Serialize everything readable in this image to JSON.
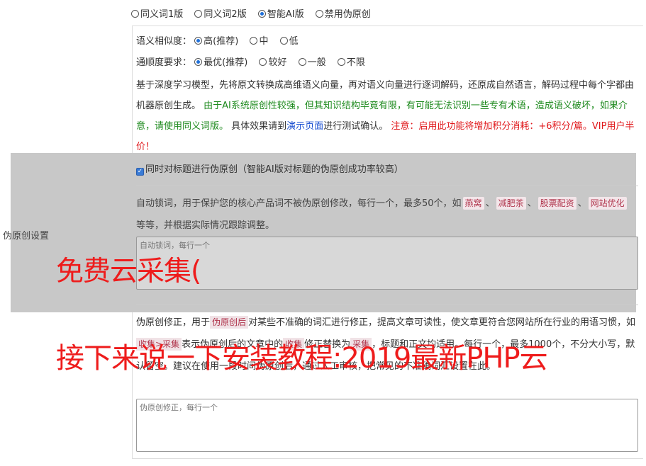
{
  "version_options": [
    {
      "label": "同义词1版",
      "selected": false
    },
    {
      "label": "同义词2版",
      "selected": false
    },
    {
      "label": "智能AI版",
      "selected": true
    },
    {
      "label": "禁用伪原创",
      "selected": false
    }
  ],
  "similarity": {
    "label": "语义相似度：",
    "options": [
      "高(推荐)",
      "中",
      "低"
    ]
  },
  "fluency": {
    "label": "通顺度要求：",
    "options": [
      "最优(推荐)",
      "较好",
      "一般",
      "不限"
    ]
  },
  "description": {
    "part1": "基于深度学习模型，先将原文转换成高维语义向量，再对语义向量进行逐词解码，还原成自然语言，解码过程中每个字都由机器原创生成。",
    "part2_green": "由于AI系统原创性较强，但其知识结构毕竟有限，有可能无法识别一些专有术语，造成语义破坏，如果介意，请使用同义词版。",
    "part3": "具体效果请到",
    "link": "演示页面",
    "part4": "进行测试确认。",
    "warning": "注意：启用此功能将增加积分消耗：+6积分/篇。VIP用户半价！"
  },
  "side_label": "伪原创设置",
  "title_checkbox": {
    "label": "同时对标题进行伪原创（智能AI版对标题的伪原创成功率较高）",
    "checked": true
  },
  "lock_words": {
    "text1": "自动锁词，用于保护您的核心产品词不被伪原创修改，每行一个，最多50个，如",
    "tags": [
      "燕窝",
      "减肥茶",
      "股票配资",
      "网站优化"
    ],
    "text2": "等等，并根据实际情况跟踪调整。",
    "placeholder": "自动锁词，每行一个"
  },
  "correction": {
    "text1": "伪原创修正，用于",
    "tag1": "伪原创后",
    "text2": "对某些不准确的词汇进行修正，提高文章可读性，使文章更符合您网站所在行业的用语习惯，如",
    "tag2": "收集>采集",
    "text3": "表示伪原创后的文章中的",
    "tag3": "收集",
    "text4": "修正替换为",
    "tag4": "采集",
    "text5": "，标题和正文均适用。每行一个，最多1000个，不分大小写，默认留空。建议在使用一段时间伪原创后，通过人工审核，把常见的不准确词汇设置在此。",
    "placeholder": "伪原创修正，每行一个"
  },
  "watermarks": {
    "line1": "免费云采集(",
    "line2": "接下来说一下安装教程:2019最新PHP云"
  }
}
